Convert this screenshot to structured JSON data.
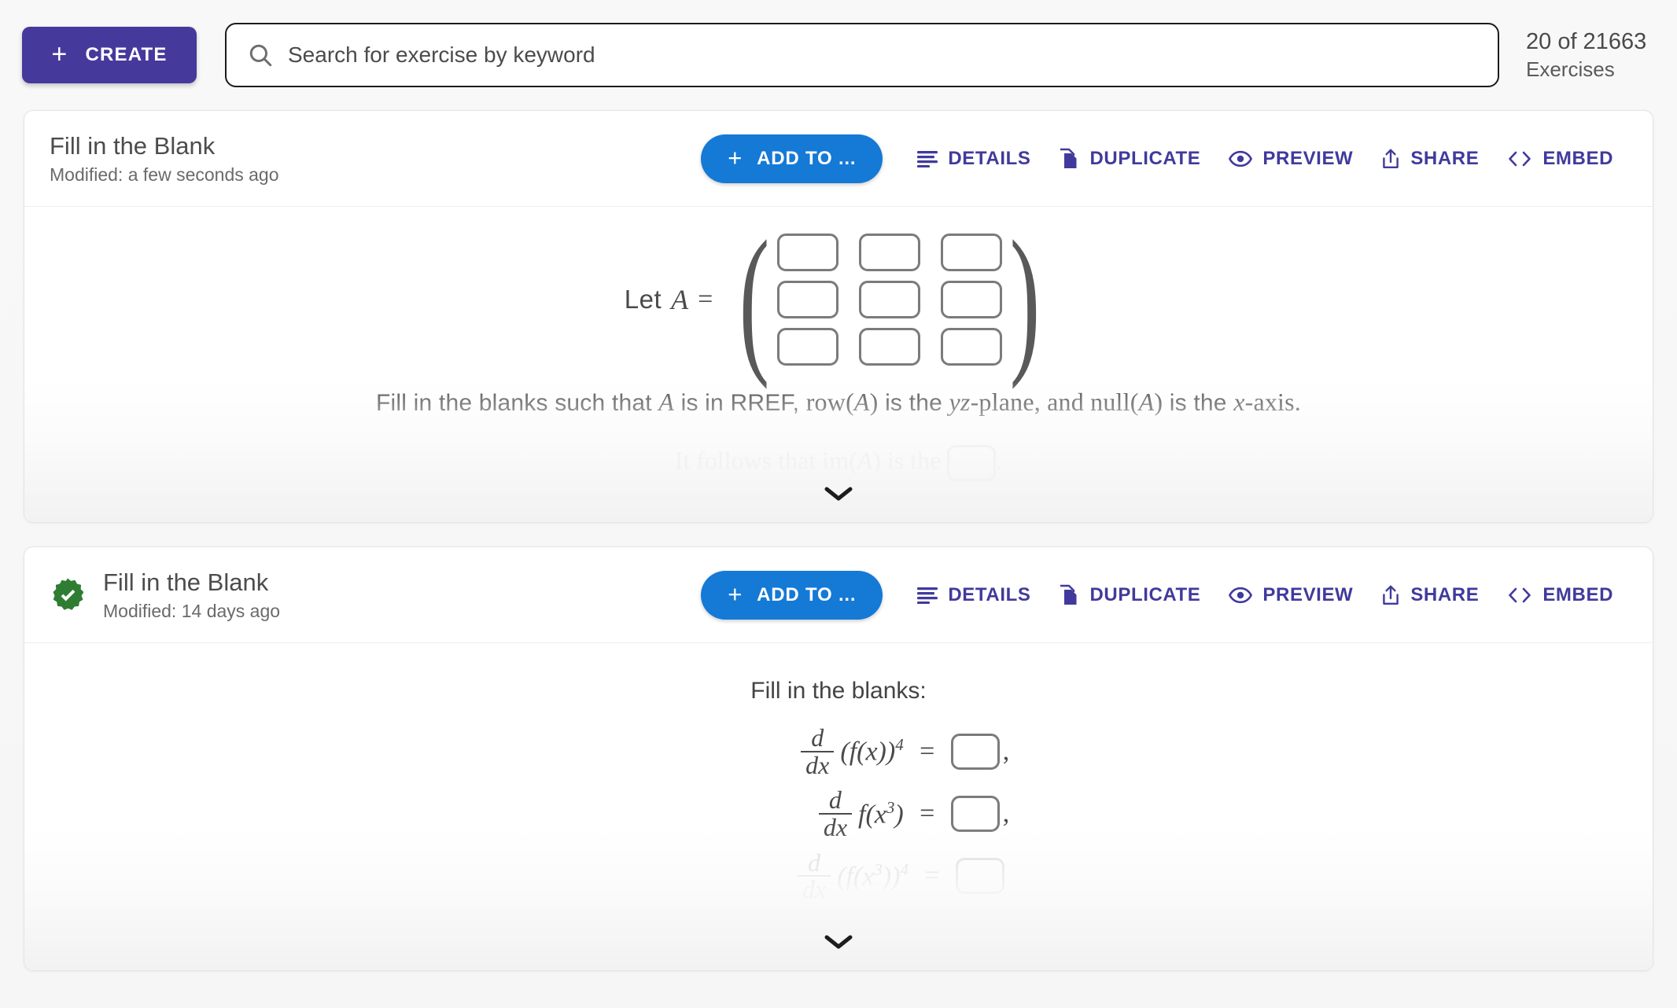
{
  "topbar": {
    "create_label": "CREATE",
    "create_icon": "plus-icon",
    "search_placeholder": "Search for exercise by keyword",
    "search_value": "",
    "search_icon": "search-icon",
    "counter_count": "20 of 21663",
    "counter_label": "Exercises",
    "accent_purple": "#46399c",
    "accent_blue": "#1579d6"
  },
  "actions": {
    "add_label": "ADD TO ...",
    "add_icon": "plus-icon",
    "details_label": "DETAILS",
    "details_icon": "list-lines-icon",
    "duplicate_label": "DUPLICATE",
    "duplicate_icon": "copy-pages-icon",
    "preview_label": "PREVIEW",
    "preview_icon": "eye-icon",
    "share_label": "SHARE",
    "share_icon": "share-upload-icon",
    "embed_label": "EMBED",
    "embed_icon": "code-brackets-icon"
  },
  "cards": [
    {
      "title": "Fill in the Blank",
      "modified": "Modified: a few seconds ago",
      "verified": false,
      "content": {
        "lead": "Let",
        "matrix_var": "A",
        "equals": "=",
        "matrix_rows": 3,
        "matrix_cols": 3,
        "prompt_parts": {
          "p1": "Fill in the blanks such that ",
          "var1": "A",
          "p2": " is in RREF, ",
          "fn1": "row",
          "var2": "A",
          "p3": " is the ",
          "axis1": "yz",
          "p4": "-plane, and ",
          "fn2": "null",
          "var3": "A",
          "p5": " is the ",
          "axis2": "x",
          "p6": "-axis."
        },
        "faded_parts": {
          "f1": "It follows that ",
          "fn": "im",
          "var": "A",
          "f2": " is the "
        }
      }
    },
    {
      "title": "Fill in the Blank",
      "modified": "Modified: 14 days ago",
      "verified": true,
      "verified_icon": "verified-check-badge-icon",
      "verified_color": "#2f7d32",
      "content": {
        "heading": "Fill in the blanks:",
        "equations": [
          {
            "num": "d",
            "den": "dx",
            "operand": "(f(x))",
            "exp": "4",
            "sign": "=",
            "trailer": ",",
            "faded": false
          },
          {
            "num": "d",
            "den": "dx",
            "operand": "f(x",
            "exp": "3",
            "operand_tail": ")",
            "sign": "=",
            "trailer": ",",
            "faded": false
          },
          {
            "num": "d",
            "den": "dx",
            "operand": "(f(x",
            "exp": "3",
            "operand_tail": "))",
            "exp2": "4",
            "sign": "=",
            "trailer": "",
            "faded": true
          }
        ]
      }
    }
  ],
  "expand_chevron_icon": "chevron-down-icon"
}
